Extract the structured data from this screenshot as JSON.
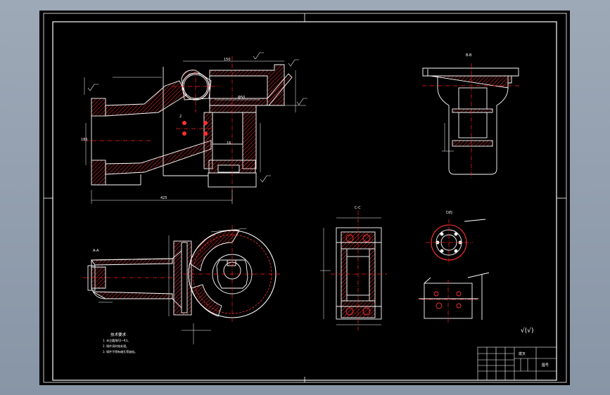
{
  "drawing": {
    "section_labels": {
      "top_right": "B-B",
      "bottom_left": "A-A",
      "bottom_center": "C-C",
      "bottom_right": "D向"
    },
    "dim_labels": {
      "overall_width": "425",
      "height_left": "185",
      "mid_a": "150",
      "mid_b": "Φ50",
      "small_a": "2",
      "small_b": "16"
    },
    "technical_requirements": {
      "title": "技术要求",
      "items": [
        "1. 未注圆角R2~R3。",
        "2. 铸件须时效处理。",
        "3. 铸件不得有缩孔等缺陷。"
      ]
    },
    "surface_finish": "√(√)",
    "title_block": {
      "name": "拨叉",
      "code": "图号"
    }
  },
  "colors": {
    "sheet": "#000000",
    "line": "#ffffff",
    "centerline": "#ff2020",
    "hatch": "#ff2020",
    "background": "#909cad"
  }
}
